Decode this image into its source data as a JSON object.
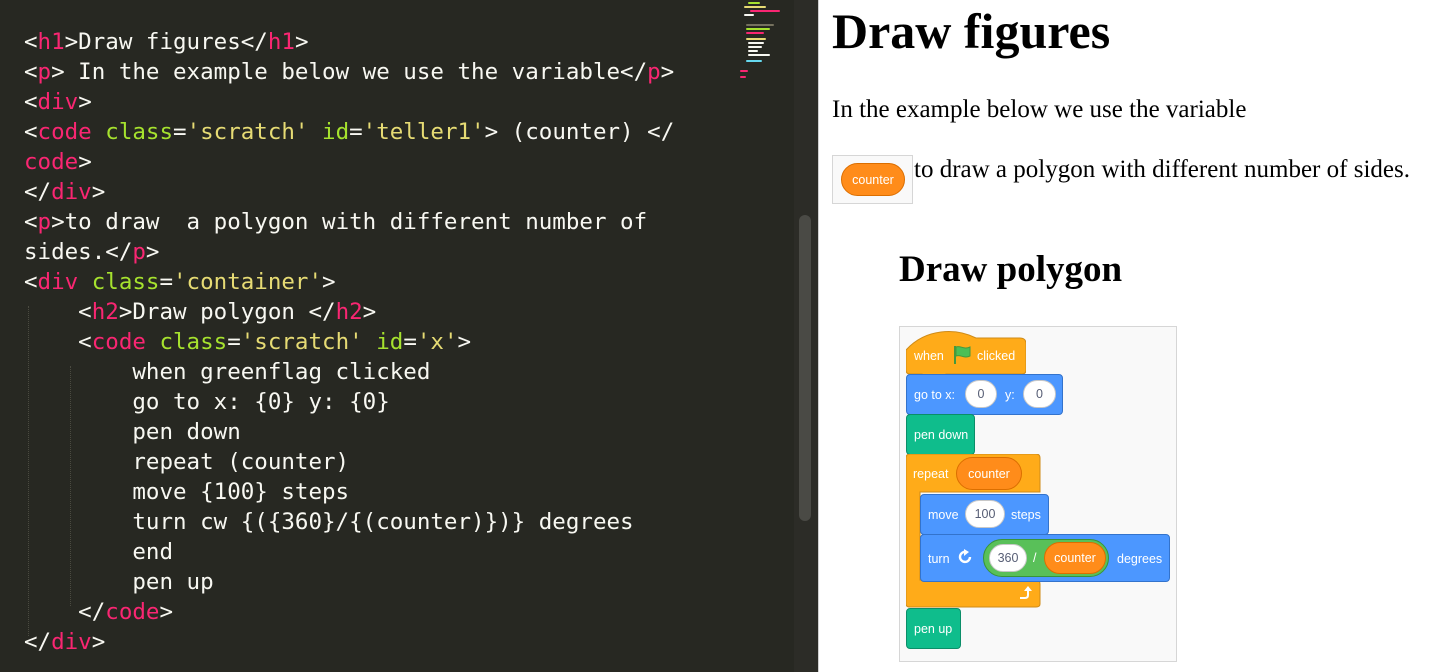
{
  "editor": {
    "lines": [
      [
        {
          "t": "<",
          "c": "txt"
        },
        {
          "t": "h1",
          "c": "tag"
        },
        {
          "t": ">Draw figures</",
          "c": "txt"
        },
        {
          "t": "h1",
          "c": "tag"
        },
        {
          "t": ">",
          "c": "txt"
        }
      ],
      [
        {
          "t": "<",
          "c": "txt"
        },
        {
          "t": "p",
          "c": "tag"
        },
        {
          "t": "> In the example below we use the variable</",
          "c": "txt"
        },
        {
          "t": "p",
          "c": "tag"
        },
        {
          "t": ">",
          "c": "txt"
        }
      ],
      [
        {
          "t": "<",
          "c": "txt"
        },
        {
          "t": "div",
          "c": "tag"
        },
        {
          "t": ">",
          "c": "txt"
        }
      ],
      [
        {
          "t": "<",
          "c": "txt"
        },
        {
          "t": "code",
          "c": "tag"
        },
        {
          "t": " ",
          "c": "txt"
        },
        {
          "t": "class",
          "c": "attr"
        },
        {
          "t": "=",
          "c": "txt"
        },
        {
          "t": "'scratch'",
          "c": "str"
        },
        {
          "t": " ",
          "c": "txt"
        },
        {
          "t": "id",
          "c": "attr"
        },
        {
          "t": "=",
          "c": "txt"
        },
        {
          "t": "'teller1'",
          "c": "str"
        },
        {
          "t": "> (counter) </",
          "c": "txt"
        }
      ],
      [
        {
          "t": "code",
          "c": "tag"
        },
        {
          "t": ">",
          "c": "txt"
        }
      ],
      [
        {
          "t": "</",
          "c": "txt"
        },
        {
          "t": "div",
          "c": "tag"
        },
        {
          "t": ">",
          "c": "txt"
        }
      ],
      [
        {
          "t": "<",
          "c": "txt"
        },
        {
          "t": "p",
          "c": "tag"
        },
        {
          "t": ">to draw  a polygon with different number of",
          "c": "txt"
        }
      ],
      [
        {
          "t": "sides.</",
          "c": "txt"
        },
        {
          "t": "p",
          "c": "tag"
        },
        {
          "t": ">",
          "c": "txt"
        }
      ],
      [
        {
          "t": "<",
          "c": "txt"
        },
        {
          "t": "div",
          "c": "tag"
        },
        {
          "t": " ",
          "c": "txt"
        },
        {
          "t": "class",
          "c": "attr"
        },
        {
          "t": "=",
          "c": "txt"
        },
        {
          "t": "'container'",
          "c": "str"
        },
        {
          "t": ">",
          "c": "txt"
        }
      ],
      [
        {
          "t": "    <",
          "c": "txt"
        },
        {
          "t": "h2",
          "c": "tag"
        },
        {
          "t": ">Draw polygon </",
          "c": "txt"
        },
        {
          "t": "h2",
          "c": "tag"
        },
        {
          "t": ">",
          "c": "txt"
        }
      ],
      [
        {
          "t": "    <",
          "c": "txt"
        },
        {
          "t": "code",
          "c": "tag"
        },
        {
          "t": " ",
          "c": "txt"
        },
        {
          "t": "class",
          "c": "attr"
        },
        {
          "t": "=",
          "c": "txt"
        },
        {
          "t": "'scratch'",
          "c": "str"
        },
        {
          "t": " ",
          "c": "txt"
        },
        {
          "t": "id",
          "c": "attr"
        },
        {
          "t": "=",
          "c": "txt"
        },
        {
          "t": "'x'",
          "c": "str"
        },
        {
          "t": ">",
          "c": "txt"
        }
      ],
      [
        {
          "t": "        when greenflag clicked",
          "c": "txt"
        }
      ],
      [
        {
          "t": "        go to x: {0} y: {0}",
          "c": "txt"
        }
      ],
      [
        {
          "t": "        pen down",
          "c": "txt"
        }
      ],
      [
        {
          "t": "        repeat (counter)",
          "c": "txt"
        }
      ],
      [
        {
          "t": "        move {100} steps",
          "c": "txt"
        }
      ],
      [
        {
          "t": "        turn cw {({360}/{(counter)})} degrees",
          "c": "txt"
        }
      ],
      [
        {
          "t": "        end",
          "c": "txt"
        }
      ],
      [
        {
          "t": "        pen up",
          "c": "txt"
        }
      ],
      [
        {
          "t": "    </",
          "c": "txt"
        },
        {
          "t": "code",
          "c": "tag"
        },
        {
          "t": ">",
          "c": "txt"
        }
      ],
      [
        {
          "t": "</",
          "c": "txt"
        },
        {
          "t": "div",
          "c": "tag"
        },
        {
          "t": ">",
          "c": "txt"
        }
      ]
    ]
  },
  "preview": {
    "h1": "Draw figures",
    "para1": "In the example below we use the variable",
    "counter_reporter": "counter",
    "para2": "to draw a polygon with different number of sides.",
    "h2": "Draw polygon",
    "script": {
      "hat_when": "when",
      "hat_clicked": "clicked",
      "goto_label": "go to x:",
      "goto_x": "0",
      "goto_y_label": "y:",
      "goto_y": "0",
      "pen_down": "pen down",
      "repeat_label": "repeat",
      "repeat_var": "counter",
      "move_label": "move",
      "move_steps": "100",
      "move_suffix": "steps",
      "turn_label": "turn",
      "turn_num": "360",
      "turn_div": "/",
      "turn_var": "counter",
      "turn_suffix": "degrees",
      "pen_up": "pen up"
    }
  },
  "colors": {
    "editor_bg": "#272822",
    "control": "#ffab19",
    "motion": "#4c97ff",
    "pen": "#0fbd8c",
    "variable": "#ff8c1a",
    "operator": "#59c059"
  }
}
